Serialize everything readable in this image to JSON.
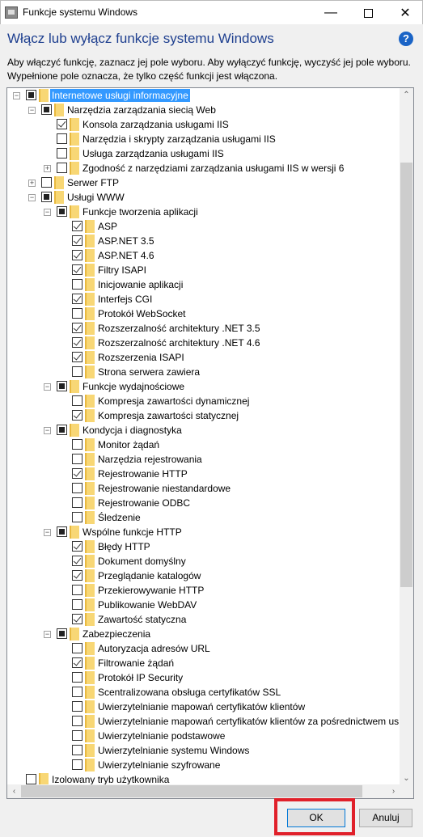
{
  "window": {
    "title": "Funkcje systemu Windows",
    "minimize_icon": "minimize-icon",
    "maximize_icon": "maximize-icon",
    "close_icon": "close-icon"
  },
  "heading": "Włącz lub wyłącz funkcje systemu Windows",
  "help_icon": "?",
  "description": "Aby włączyć funkcję, zaznacz jej pole wyboru. Aby wyłączyć funkcję, wyczyść jej pole wyboru. Wypełnione pole oznacza, że tylko część funkcji jest włączona.",
  "colors": {
    "heading": "#1e3f8f",
    "selection": "#3399ff",
    "highlight_box": "#e0202a",
    "ok_border": "#0078d7"
  },
  "tree": [
    {
      "level": 0,
      "exp": "-",
      "state": "partial",
      "label": "Internetowe usługi informacyjne",
      "selected": true
    },
    {
      "level": 1,
      "exp": "-",
      "state": "partial",
      "label": "Narzędzia zarządzania siecią Web"
    },
    {
      "level": 2,
      "state": "checked",
      "label": "Konsola zarządzania usługami IIS"
    },
    {
      "level": 2,
      "state": "unchecked",
      "label": "Narzędzia i skrypty zarządzania usługami IIS"
    },
    {
      "level": 2,
      "state": "unchecked",
      "label": "Usługa zarządzania usługami IIS"
    },
    {
      "level": 2,
      "exp": "+",
      "state": "unchecked",
      "label": "Zgodność z narzędziami zarządzania usługami IIS w wersji 6"
    },
    {
      "level": 1,
      "exp": "+",
      "state": "unchecked",
      "label": "Serwer FTP"
    },
    {
      "level": 1,
      "exp": "-",
      "state": "partial",
      "label": "Usługi WWW"
    },
    {
      "level": 2,
      "exp": "-",
      "state": "partial",
      "label": "Funkcje tworzenia aplikacji"
    },
    {
      "level": 3,
      "state": "checked",
      "label": "ASP"
    },
    {
      "level": 3,
      "state": "checked",
      "label": "ASP.NET 3.5"
    },
    {
      "level": 3,
      "state": "checked",
      "label": "ASP.NET 4.6"
    },
    {
      "level": 3,
      "state": "checked",
      "label": "Filtry ISAPI"
    },
    {
      "level": 3,
      "state": "unchecked",
      "label": "Inicjowanie aplikacji"
    },
    {
      "level": 3,
      "state": "checked",
      "label": "Interfejs CGI"
    },
    {
      "level": 3,
      "state": "unchecked",
      "label": "Protokół WebSocket"
    },
    {
      "level": 3,
      "state": "checked",
      "label": "Rozszerzalność architektury .NET 3.5"
    },
    {
      "level": 3,
      "state": "checked",
      "label": "Rozszerzalność architektury .NET 4.6"
    },
    {
      "level": 3,
      "state": "checked",
      "label": "Rozszerzenia ISAPI"
    },
    {
      "level": 3,
      "state": "unchecked",
      "label": "Strona serwera zawiera"
    },
    {
      "level": 2,
      "exp": "-",
      "state": "partial",
      "label": "Funkcje wydajnościowe"
    },
    {
      "level": 3,
      "state": "unchecked",
      "label": "Kompresja zawartości dynamicznej"
    },
    {
      "level": 3,
      "state": "checked",
      "label": "Kompresja zawartości statycznej"
    },
    {
      "level": 2,
      "exp": "-",
      "state": "partial",
      "label": "Kondycja i diagnostyka"
    },
    {
      "level": 3,
      "state": "unchecked",
      "label": "Monitor żądań"
    },
    {
      "level": 3,
      "state": "unchecked",
      "label": "Narzędzia rejestrowania"
    },
    {
      "level": 3,
      "state": "checked",
      "label": "Rejestrowanie HTTP"
    },
    {
      "level": 3,
      "state": "unchecked",
      "label": "Rejestrowanie niestandardowe"
    },
    {
      "level": 3,
      "state": "unchecked",
      "label": "Rejestrowanie ODBC"
    },
    {
      "level": 3,
      "state": "unchecked",
      "label": "Śledzenie"
    },
    {
      "level": 2,
      "exp": "-",
      "state": "partial",
      "label": "Wspólne funkcje HTTP"
    },
    {
      "level": 3,
      "state": "checked",
      "label": "Błędy HTTP"
    },
    {
      "level": 3,
      "state": "checked",
      "label": "Dokument domyślny"
    },
    {
      "level": 3,
      "state": "checked",
      "label": "Przeglądanie katalogów"
    },
    {
      "level": 3,
      "state": "unchecked",
      "label": "Przekierowywanie HTTP"
    },
    {
      "level": 3,
      "state": "unchecked",
      "label": "Publikowanie WebDAV"
    },
    {
      "level": 3,
      "state": "checked",
      "label": "Zawartość statyczna"
    },
    {
      "level": 2,
      "exp": "-",
      "state": "partial",
      "label": "Zabezpieczenia"
    },
    {
      "level": 3,
      "state": "unchecked",
      "label": "Autoryzacja adresów URL"
    },
    {
      "level": 3,
      "state": "checked",
      "label": "Filtrowanie żądań"
    },
    {
      "level": 3,
      "state": "unchecked",
      "label": "Protokół IP Security"
    },
    {
      "level": 3,
      "state": "unchecked",
      "label": "Scentralizowana obsługa certyfikatów SSL"
    },
    {
      "level": 3,
      "state": "unchecked",
      "label": "Uwierzytelnianie mapowań certyfikatów klientów"
    },
    {
      "level": 3,
      "state": "unchecked",
      "label": "Uwierzytelnianie mapowań certyfikatów klientów za pośrednictwem us"
    },
    {
      "level": 3,
      "state": "unchecked",
      "label": "Uwierzytelnianie podstawowe"
    },
    {
      "level": 3,
      "state": "unchecked",
      "label": "Uwierzytelnianie systemu Windows"
    },
    {
      "level": 3,
      "state": "unchecked",
      "label": "Uwierzytelnianie szyfrowane"
    },
    {
      "level": 0,
      "state": "unchecked",
      "label": "Izolowany tryb użytkownika"
    }
  ],
  "buttons": {
    "ok": "OK",
    "cancel": "Anuluj"
  }
}
